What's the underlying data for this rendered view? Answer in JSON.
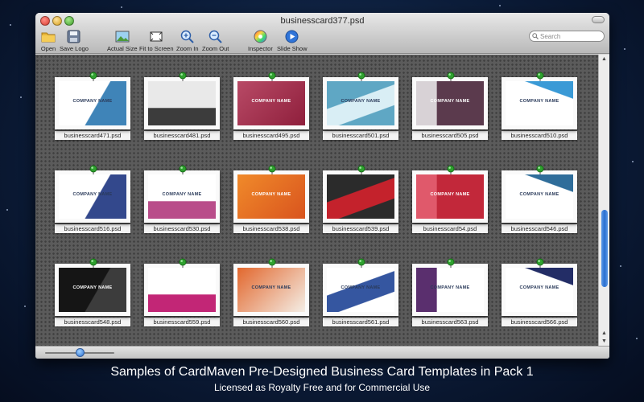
{
  "window": {
    "title": "businesscard377.psd"
  },
  "toolbar": {
    "items": [
      {
        "label": "Open",
        "icon": "folder-icon"
      },
      {
        "label": "Save Logo",
        "icon": "save-icon"
      },
      {
        "label": "Actual Size",
        "icon": "image-icon"
      },
      {
        "label": "Fit to Screen",
        "icon": "fit-screen-icon"
      },
      {
        "label": "Zoom In",
        "icon": "zoom-in-icon"
      },
      {
        "label": "Zoom Out",
        "icon": "zoom-out-icon"
      },
      {
        "label": "Inspector",
        "icon": "color-wheel-icon"
      },
      {
        "label": "Slide Show",
        "icon": "play-icon"
      }
    ],
    "search_placeholder": "Search"
  },
  "cards": [
    {
      "file": "businesscard471.psd",
      "text": "COMPANY NAME",
      "colors": [
        "#ffffff",
        "#3f84b8"
      ]
    },
    {
      "file": "businesscard481.psd",
      "text": "",
      "colors": [
        "#e9e9e9",
        "#3c3c3c"
      ]
    },
    {
      "file": "businesscard495.psd",
      "text": "COMPANY NAME",
      "colors": [
        "#8f1f3c",
        "#b84a66"
      ]
    },
    {
      "file": "businesscard501.psd",
      "text": "COMPANY NAME",
      "colors": [
        "#5fa7c4",
        "#d9eef5"
      ]
    },
    {
      "file": "businesscard505.psd",
      "text": "COMPANY NAME",
      "colors": [
        "#5b3a4d",
        "#d8d2d6"
      ]
    },
    {
      "file": "businesscard510.psd",
      "text": "COMPANY NAME",
      "colors": [
        "#ffffff",
        "#3a9ad6"
      ]
    },
    {
      "file": "businesscard516.psd",
      "text": "COMPANY NAME",
      "colors": [
        "#ffffff",
        "#33488c"
      ]
    },
    {
      "file": "businesscard530.psd",
      "text": "COMPANY NAME",
      "colors": [
        "#ffffff",
        "#b94d8a"
      ]
    },
    {
      "file": "businesscard538.psd",
      "text": "COMPANY NAME",
      "colors": [
        "#d9541e",
        "#f08a2a"
      ]
    },
    {
      "file": "businesscard539.psd",
      "text": "",
      "colors": [
        "#2b2b2b",
        "#c4222c"
      ]
    },
    {
      "file": "businesscard54.psd",
      "text": "COMPANY NAME",
      "colors": [
        "#c2283a",
        "#e0596b"
      ]
    },
    {
      "file": "businesscard546.psd",
      "text": "COMPANY NAME",
      "colors": [
        "#ffffff",
        "#2f6d9a"
      ]
    },
    {
      "file": "businesscard548.psd",
      "text": "COMPANY NAME",
      "colors": [
        "#151515",
        "#3c3c3c"
      ]
    },
    {
      "file": "businesscard559.psd",
      "text": "",
      "colors": [
        "#ffffff",
        "#c22676"
      ]
    },
    {
      "file": "businesscard560.psd",
      "text": "COMPANY NAME",
      "colors": [
        "#f4eee6",
        "#e2672d"
      ]
    },
    {
      "file": "businesscard561.psd",
      "text": "COMPANY NAME",
      "colors": [
        "#ffffff",
        "#3556a0"
      ]
    },
    {
      "file": "businesscard563.psd",
      "text": "COMPANY NAME",
      "colors": [
        "#ffffff",
        "#5a2f6e"
      ]
    },
    {
      "file": "businesscard566.psd",
      "text": "COMPANY NAME",
      "colors": [
        "#ffffff",
        "#232d66"
      ]
    }
  ],
  "promo": {
    "line1": "Samples of CardMaven Pre-Designed Business Card  Templates in Pack 1",
    "line2": "Licensed as Royalty Free and for Commercial Use"
  },
  "zoom_slider": {
    "level": 0.5
  },
  "scroll": {
    "position": 0.75
  }
}
